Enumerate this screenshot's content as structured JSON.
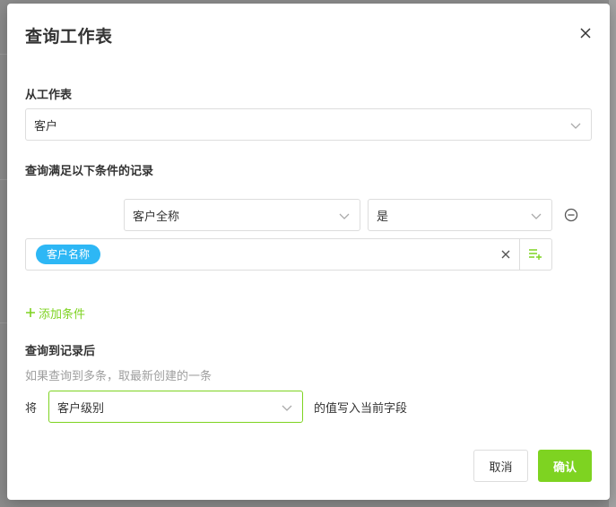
{
  "dialog": {
    "title": "查询工作表",
    "close_icon": "close-icon"
  },
  "source": {
    "label": "从工作表",
    "selected": "客户"
  },
  "conditions": {
    "label": "查询满足以下条件的记录",
    "items": [
      {
        "field": "客户全称",
        "operator": "是",
        "value_tag": "客户名称"
      }
    ],
    "add_label": "添加条件"
  },
  "after_query": {
    "label": "查询到记录后",
    "hint": "如果查询到多条，取最新创建的一条",
    "prefix": "将",
    "field_selected": "客户级别",
    "suffix": "的值写入当前字段"
  },
  "footer": {
    "cancel_label": "取消",
    "confirm_label": "确认"
  },
  "colors": {
    "accent": "#7ed321",
    "tag": "#2db7f5"
  }
}
